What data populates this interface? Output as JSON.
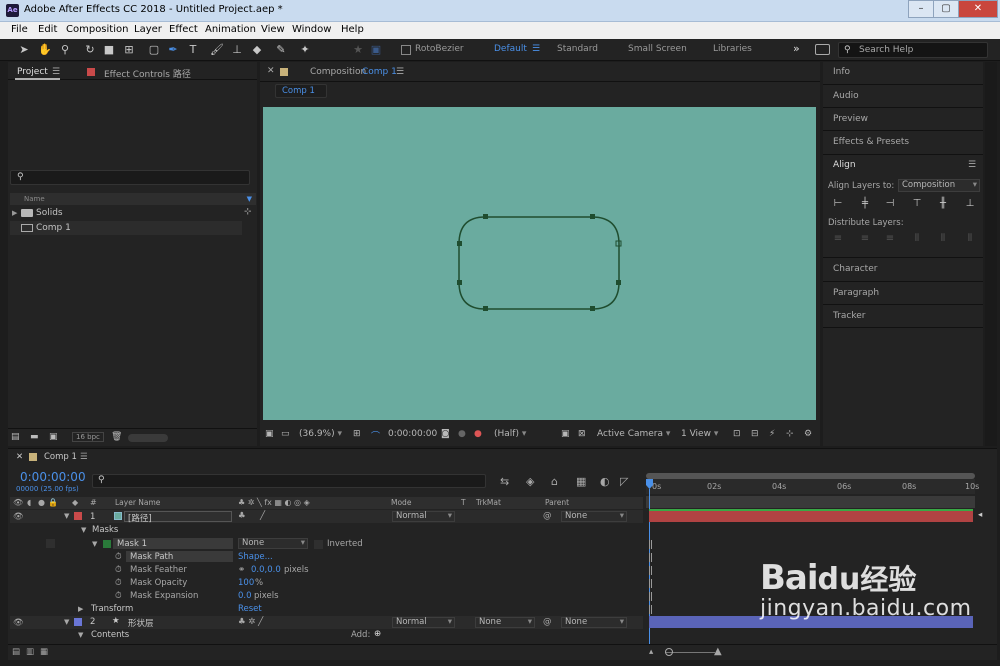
{
  "window": {
    "title": "Adobe After Effects CC 2018 - Untitled Project.aep *",
    "logo": "Ae",
    "buttons": {
      "minimize": "–",
      "maximize": "▢",
      "close": "✕"
    }
  },
  "menu": [
    "File",
    "Edit",
    "Composition",
    "Layer",
    "Effect",
    "Animation",
    "View",
    "Window",
    "Help"
  ],
  "toolbar": {
    "rotobezier_label": "RotoBezier",
    "workspaces": [
      "Default",
      "Standard",
      "Small Screen",
      "Libraries"
    ],
    "active_workspace": "Default",
    "more": "»",
    "search_placeholder": "Search Help"
  },
  "project_panel": {
    "tab_project": "Project",
    "tab_effect_controls": "Effect Controls 路径",
    "column_name": "Name",
    "items": [
      {
        "label": "Solids",
        "type": "folder"
      },
      {
        "label": "Comp 1",
        "type": "comp"
      }
    ],
    "bpc": "16 bpc"
  },
  "composition_panel": {
    "tab_prefix": "Composition",
    "tab_name": "Comp 1",
    "subtab": "Comp 1",
    "canvas_color": "#6aab9f",
    "shape_color": "#1f4d2f",
    "zoom": "(36.9%)",
    "timecode": "0:00:00:00",
    "resolution": "(Half)",
    "camera": "Active Camera",
    "views": "1 View"
  },
  "right_panels": {
    "items": [
      "Info",
      "Audio",
      "Preview",
      "Effects & Presets",
      "Align",
      "Character",
      "Paragraph",
      "Tracker"
    ],
    "align": {
      "align_layers_to_label": "Align Layers to:",
      "align_layers_to_value": "Composition",
      "distribute_label": "Distribute Layers:"
    }
  },
  "timeline": {
    "tab": "Comp 1",
    "timecode": "0:00:00:00",
    "fps": "00000 (25.00 fps)",
    "columns": {
      "layer_name": "Layer Name",
      "mode": "Mode",
      "t": "T",
      "trkmat": "TrkMat",
      "parent": "Parent"
    },
    "ruler": [
      "0s",
      "02s",
      "04s",
      "06s",
      "08s",
      "10s"
    ],
    "layers": [
      {
        "number": "1",
        "name": "[路径]",
        "mode": "Normal",
        "parent": "None",
        "color": "#c94a4a",
        "track_color": "#b14343"
      },
      {
        "number": "2",
        "name": "形状层",
        "mode": "Normal",
        "trkmat": "None",
        "parent": "None",
        "color": "#6a76d6",
        "track_color": "#5a64b8"
      }
    ],
    "masks_label": "Masks",
    "mask1": {
      "name": "Mask 1",
      "mode": "None",
      "inverted": "Inverted"
    },
    "mask_props": [
      {
        "name": "Mask Path",
        "value": "Shape..."
      },
      {
        "name": "Mask Feather",
        "value": "0.0,0.0",
        "unit": "pixels"
      },
      {
        "name": "Mask Opacity",
        "value": "100",
        "unit": "%"
      },
      {
        "name": "Mask Expansion",
        "value": "0.0",
        "unit": "pixels"
      }
    ],
    "transform": {
      "label": "Transform",
      "value": "Reset"
    },
    "contents": {
      "label": "Contents",
      "add": "Add:"
    }
  },
  "watermark": {
    "brand": "Bai",
    "paw": "du",
    "suffix": "经验",
    "url": "jingyan.baidu.com"
  },
  "accent_color": "#4a90e8"
}
